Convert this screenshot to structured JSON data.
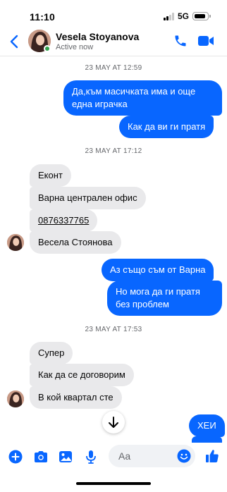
{
  "status_bar": {
    "time": "11:10",
    "network": "5G"
  },
  "header": {
    "contact_name": "Vesela Stoyanova",
    "status": "Active now"
  },
  "timestamps": {
    "t1": "23 MAY AT 12:59",
    "t2": "23 MAY AT 17:12",
    "t3": "23 MAY AT 17:53"
  },
  "messages": {
    "m1_line1": "Да,към масичката има  и още",
    "m1_line2": "една играчка",
    "m2": "Как да ви ги пратя",
    "m3": "Еконт",
    "m4": "Варна централен офис",
    "m5": "0876337765",
    "m6": "Весела Стоянова",
    "m7": "Аз също съм от Варна",
    "m8_line1": "Но мога да ги пратя",
    "m8_line2": "без проблем",
    "m9": "Супер",
    "m10": "Как да се договорим",
    "m11": "В кой квартал сте",
    "m12": "ХЕИ"
  },
  "composer": {
    "placeholder": "Aa"
  },
  "colors": {
    "accent": "#0866ff",
    "incoming_bubble": "#e9e9eb",
    "online": "#31a24c"
  },
  "icons": [
    "chevron-left-icon",
    "phone-icon",
    "video-camera-icon",
    "arrow-down-icon",
    "plus-circle-icon",
    "camera-icon",
    "image-icon",
    "microphone-icon",
    "emoji-icon",
    "thumbs-up-icon"
  ]
}
